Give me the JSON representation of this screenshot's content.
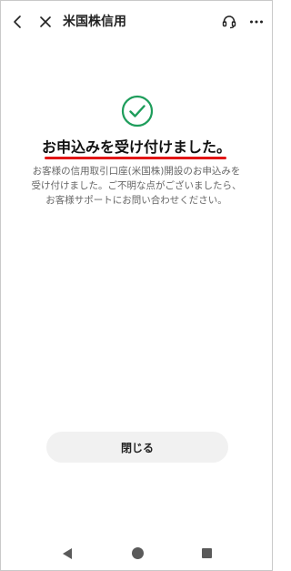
{
  "header": {
    "title": "米国株信用",
    "back_icon": "chevron-left-icon",
    "close_icon": "close-icon",
    "support_icon": "headset-icon",
    "more_icon": "more-horizontal-icon"
  },
  "main": {
    "status_icon": "check-circle-icon",
    "heading": "お申込みを受け付けました。",
    "message": "お客様の信用取引口座(米国株)開設のお申込みを\n受け付けました。ご不明な点がございましたら、\nお客様サポートにお問い合わせください。",
    "close_button_label": "閉じる"
  },
  "colors": {
    "accent_green": "#1e9d5b",
    "underline_red": "#e21616",
    "button_bg": "#f1f1f1"
  },
  "system_nav": {
    "back_icon": "triangle-back-icon",
    "home_icon": "circle-home-icon",
    "recent_icon": "square-recent-icon"
  }
}
